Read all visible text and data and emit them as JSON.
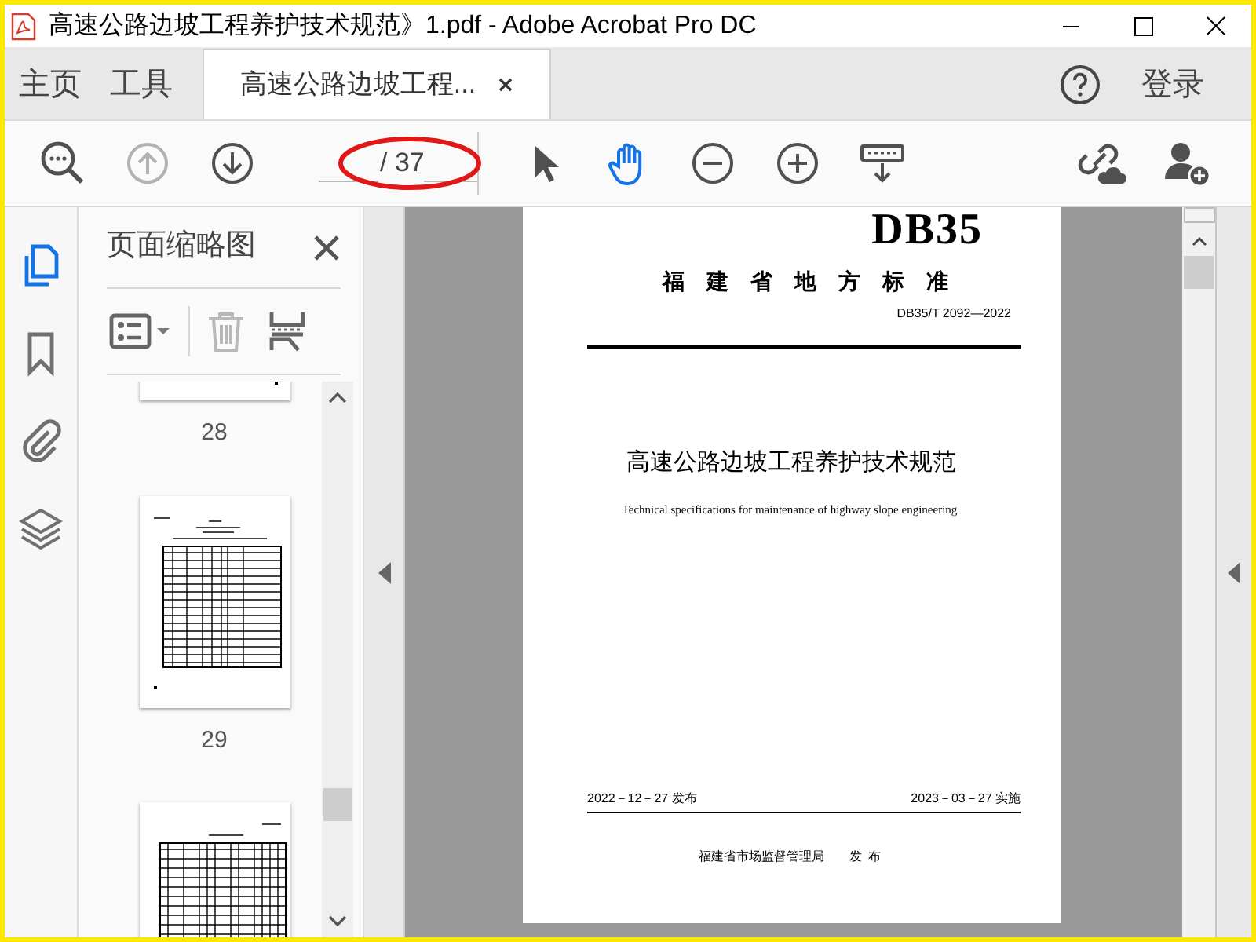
{
  "window": {
    "title": "高速公路边坡工程养护技术规范》1.pdf - Adobe Acrobat Pro DC"
  },
  "tabs": [
    {
      "label": "主页",
      "selected": false
    },
    {
      "label": "工具",
      "selected": false
    },
    {
      "label": "高速公路边坡工程...",
      "selected": true
    }
  ],
  "sign_in": "登录",
  "toolbar": {
    "tools": [
      {
        "kind": "find",
        "disabled": false,
        "selected": false
      },
      {
        "kind": "prev",
        "disabled": true,
        "selected": false
      },
      {
        "kind": "next",
        "disabled": false,
        "selected": false
      },
      {
        "kind": "page"
      },
      {
        "kind": "select",
        "disabled": false,
        "selected": false
      },
      {
        "kind": "hand",
        "disabled": false,
        "selected": true
      },
      {
        "kind": "zoom-out",
        "disabled": false,
        "selected": false
      },
      {
        "kind": "zoom-in",
        "disabled": false,
        "selected": false
      },
      {
        "kind": "fit",
        "disabled": false,
        "selected": false
      },
      {
        "kind": "gap"
      },
      {
        "kind": "share",
        "disabled": false,
        "selected": false
      },
      {
        "kind": "add-user",
        "disabled": false,
        "selected": false
      }
    ],
    "page_count": "/ 37",
    "annotation": {
      "kind": "ellipse"
    }
  },
  "sidebar": {
    "items": [
      {
        "kind": "pages",
        "selected": true
      },
      {
        "kind": "bookmarks",
        "selected": false
      },
      {
        "kind": "attachments",
        "selected": false
      },
      {
        "kind": "layers",
        "selected": false
      }
    ]
  },
  "thumbnail_panel": {
    "title": "页面缩略图",
    "delete_disabled": true,
    "thumbnails": [
      {
        "kind": "partial",
        "label": "28"
      },
      {
        "kind": "form",
        "label": "29"
      },
      {
        "kind": "table"
      }
    ]
  },
  "document": {
    "logo": "DB35",
    "authority": "福　建　省　地　方　标　准",
    "code": "DB35/T 2092—2022",
    "title_cn": "高速公路边坡工程养护技术规范",
    "title_en": "Technical specifications for maintenance of highway slope engineering",
    "issue_date": "2022－12－27 发布",
    "effective_date": "2023－03－27 实施",
    "issuer": "福建省市场监督管理局",
    "issuer_action": "发  布"
  }
}
